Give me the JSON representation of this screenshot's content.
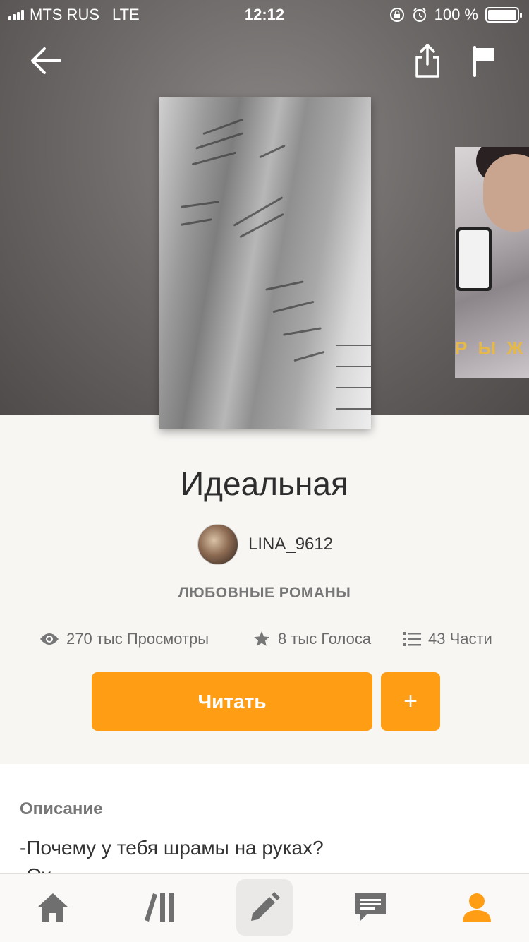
{
  "status_bar": {
    "carrier": "MTS RUS",
    "network": "LTE",
    "time": "12:12",
    "battery": "100 %"
  },
  "header": {
    "icons": [
      "back-arrow-icon",
      "share-icon",
      "flag-icon"
    ]
  },
  "story": {
    "title": "Идеальная",
    "author": "LINA_9612",
    "genre": "ЛЮБОВНЫЕ РОМАНЫ",
    "stats": {
      "views": "270 тыс Просмотры",
      "votes": "8 тыс Голоса",
      "parts": "43 Части"
    },
    "next_cover_text": "Р Ы Ж"
  },
  "actions": {
    "read_label": "Читать",
    "add_label": "+"
  },
  "description": {
    "heading": "Описание",
    "line1": "-Почему у тебя шрамы на руках?",
    "line2": "-Ох..."
  },
  "tabbar": {
    "items": [
      "home-icon",
      "library-icon",
      "write-icon",
      "inbox-icon",
      "profile-icon"
    ]
  },
  "colors": {
    "accent": "#ff9d14",
    "hero_bg": "#6e6a69",
    "page_bg": "#f8f6f3"
  }
}
